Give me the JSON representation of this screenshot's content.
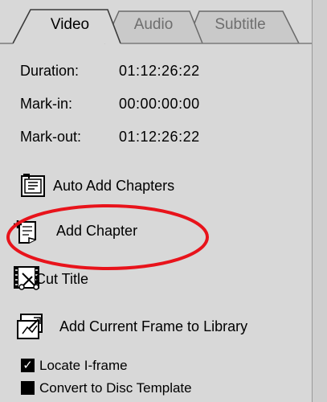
{
  "tabs": [
    {
      "label": "Video",
      "active": true
    },
    {
      "label": "Audio",
      "active": false
    },
    {
      "label": "Subtitle",
      "active": false
    }
  ],
  "info": {
    "duration_label": "Duration:",
    "duration_value": "01:12:26:22",
    "markin_label": "Mark-in:",
    "markin_value": "00:00:00:00",
    "markout_label": "Mark-out:",
    "markout_value": "01:12:26:22"
  },
  "actions": {
    "auto_add_chapters": "Auto Add Chapters",
    "add_chapter": "Add Chapter",
    "cut_title": "Cut Title",
    "add_frame_to_library": "Add Current Frame to Library"
  },
  "options": {
    "locate_iframe": {
      "label": "Locate I-frame",
      "checked": true
    },
    "convert_template": {
      "label": "Convert to Disc Template",
      "checked": false
    }
  },
  "colors": {
    "panel_bg": "#d8d8d8",
    "highlight_ellipse": "#e8131b",
    "inactive_tab_text": "#6e6e6e"
  },
  "icons": {
    "auto_add_chapters": "auto-chapter-icon",
    "add_chapter": "add-chapter-icon",
    "cut_title": "cut-film-icon",
    "add_frame_to_library": "frame-library-icon"
  }
}
